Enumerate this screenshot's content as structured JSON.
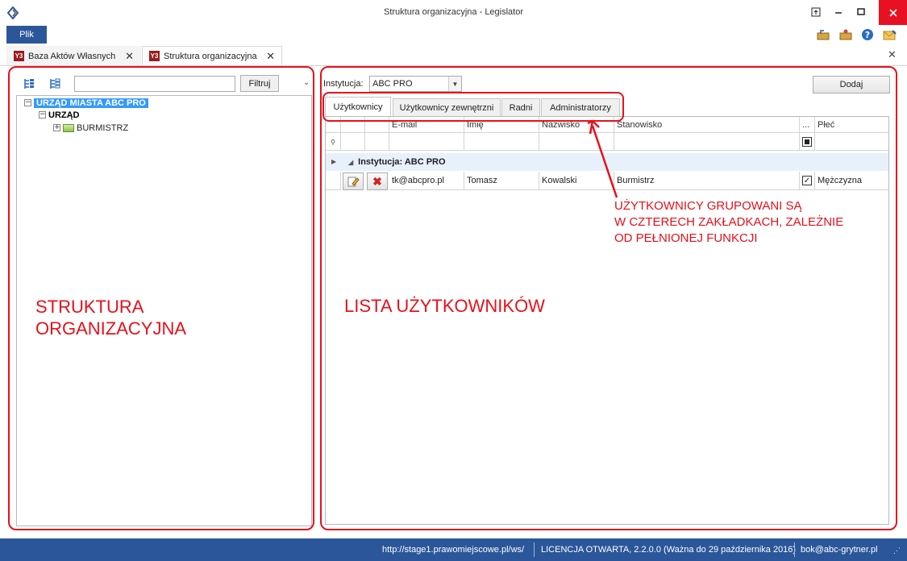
{
  "window": {
    "title": "Struktura organizacyjna - Legislator",
    "controls": {
      "pin": "⊡",
      "minimize": "—",
      "maximize": "▭",
      "close": "✕"
    }
  },
  "menu": {
    "file_label": "Plik"
  },
  "ribbon_icons": [
    "export-icon",
    "import-icon",
    "help-icon",
    "mail-icon"
  ],
  "doc_tabs": [
    {
      "label": "Baza Aktów Własnych",
      "icon": "app-doc-icon"
    },
    {
      "label": "Struktura organizacyjna",
      "icon": "app-doc-icon"
    }
  ],
  "left": {
    "filter_placeholder": "",
    "filter_button": "Filtruj",
    "tree": {
      "root": "URZĄD MIASTA ABC PRO",
      "child": "URZĄD",
      "leaf": "BURMISTRZ"
    }
  },
  "right": {
    "institution_label": "Instytucja:",
    "institution_value": "ABC PRO",
    "add_button": "Dodaj",
    "tabs": [
      "Użytkownicy",
      "Użytkownicy zewnętrzni",
      "Radni",
      "Administratorzy"
    ],
    "grid": {
      "columns": [
        "E-mail",
        "Imię",
        "Nazwisko",
        "Stanowisko",
        "...",
        "Płeć"
      ],
      "group_label": "Instytucja: ABC PRO",
      "rows": [
        {
          "email": "tk@abcpro.pl",
          "imie": "Tomasz",
          "nazwisko": "Kowalski",
          "stanowisko": "Burmistrz",
          "checked": true,
          "plec": "Mężczyzna"
        }
      ]
    }
  },
  "annotations": {
    "left_label_line1": "STRUKTURA",
    "left_label_line2": "ORGANIZACYJNA",
    "right_label": "LISTA UŻYTKOWNIKÓW",
    "callout_line1": "UŻYTKOWNICY GRUPOWANI SĄ",
    "callout_line2": "W CZTERECH ZAKŁADKACH, ZALEŻNIE",
    "callout_line3": "OD PEŁNIONEJ FUNKCJI",
    "color": "#e8101a"
  },
  "status": {
    "url": "http://stage1.prawomiejscowe.pl/ws/",
    "license": "LICENCJA OTWARTA, 2.2.0.0 (Ważna do 29 października 2016)",
    "email": "bok@abc-grytner.pl",
    "accent": "#2b579a"
  }
}
